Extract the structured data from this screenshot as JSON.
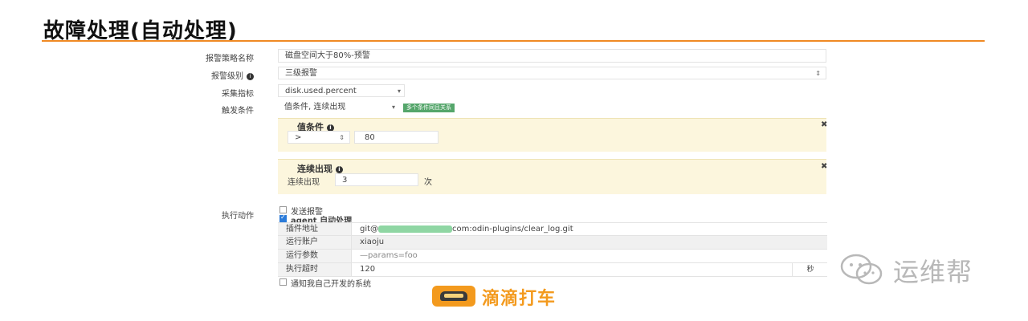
{
  "title": "故障处理(自动处理)",
  "form": {
    "strategy_name_label": "报警策略名称",
    "strategy_name_value": "磁盘空间大于80%-预警",
    "level_label": "报警级别",
    "level_value": "三级报警",
    "level_caret": "⇕",
    "metric_label": "采集指标",
    "metric_value": "disk.used.percent",
    "metric_caret": "▾",
    "trigger_label": "触发条件",
    "trigger_value": "值条件, 连续出现",
    "trigger_caret": "▾",
    "trigger_tag": "多个条件同且关系"
  },
  "value_condition": {
    "title": "值条件",
    "operator": ">",
    "operator_caret": "⇕",
    "threshold": "80",
    "close": "✖"
  },
  "consecutive": {
    "title": "连续出现",
    "label": "连续出现",
    "count": "3",
    "unit": "次",
    "close": "✖"
  },
  "actions": {
    "label": "执行动作",
    "send_alarm": "发送报警",
    "send_alarm_checked": false,
    "agent_auto": "agent 自动处理",
    "agent_auto_checked": true,
    "plugin_addr_label": "插件地址",
    "plugin_addr_prefix": "git@",
    "plugin_addr_suffix": "com:odin-plugins/clear_log.git",
    "run_user_label": "运行账户",
    "run_user_value": "xiaoju",
    "run_params_label": "运行参数",
    "run_params_value": "—params=foo",
    "timeout_label": "执行超时",
    "timeout_value": "120",
    "timeout_unit": "秒",
    "notify_own": "通知我自己开发的系统",
    "notify_own_checked": false
  },
  "watermarks": {
    "didi": "滴滴打车",
    "wechat": "运维帮"
  },
  "colors": {
    "accent_line": "#f08a24",
    "panel_bg": "#fcf6dd",
    "tag_green": "#55a66b",
    "didi_orange": "#f39a1e"
  }
}
